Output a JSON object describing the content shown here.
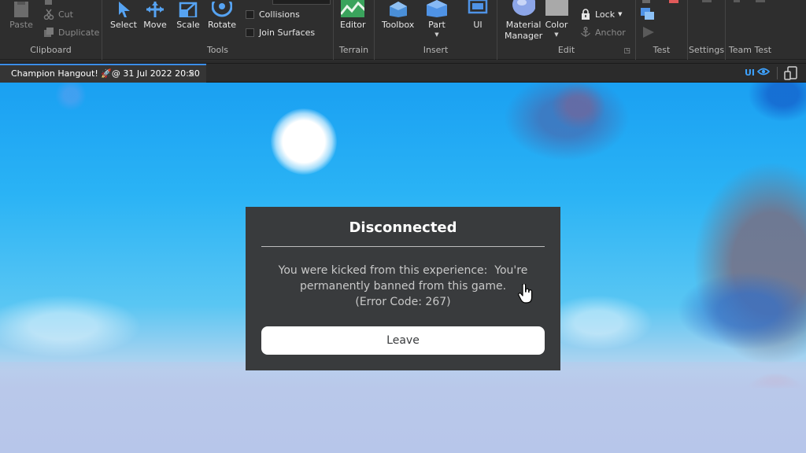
{
  "ribbon": {
    "clipboard": {
      "paste_label": "Paste",
      "cut_label": "Cut",
      "duplicate_label": "Duplicate",
      "group_label": "Clipboard"
    },
    "tools": {
      "select_label": "Select",
      "move_label": "Move",
      "scale_label": "Scale",
      "rotate_label": "Rotate",
      "collisions_label": "Collisions",
      "join_surfaces_label": "Join Surfaces",
      "group_label": "Tools"
    },
    "terrain": {
      "editor_label": "Editor",
      "group_label": "Terrain"
    },
    "insert": {
      "toolbox_label": "Toolbox",
      "part_label": "Part",
      "ui_label": "UI",
      "group_label": "Insert"
    },
    "edit": {
      "material_label": "Material\nManager",
      "color_label": "Color",
      "lock_label": "Lock",
      "anchor_label": "Anchor",
      "group_label": "Edit"
    },
    "test": {
      "group_label": "Test"
    },
    "settings": {
      "group_label": "Settings"
    },
    "team_test": {
      "group_label": "Team Test"
    }
  },
  "tabbar": {
    "doc_tab_label": "Champion Hangout! 🚀@ 31 Jul 2022 20:50",
    "ui_toggle_label": "UI"
  },
  "dialog": {
    "title": "Disconnected",
    "message_line1": "You were kicked from this experience:  You're",
    "message_line2": "permanently banned from this game.",
    "message_line3": "(Error Code: 267)",
    "leave_label": "Leave"
  },
  "colors": {
    "accent": "#3b8de8",
    "dialog_bg": "#393b3d",
    "ribbon_bg": "#2e2e2e"
  },
  "icons": [
    "paste-icon",
    "cut-icon",
    "duplicate-icon",
    "select-arrow-icon",
    "move-icon",
    "scale-icon",
    "rotate-icon",
    "terrain-editor-icon",
    "toolbox-icon",
    "part-icon",
    "ui-icon",
    "material-manager-icon",
    "color-icon",
    "lock-icon",
    "anchor-icon",
    "play-icon",
    "close-icon",
    "eye-icon",
    "device-icon",
    "hand-cursor-icon"
  ]
}
